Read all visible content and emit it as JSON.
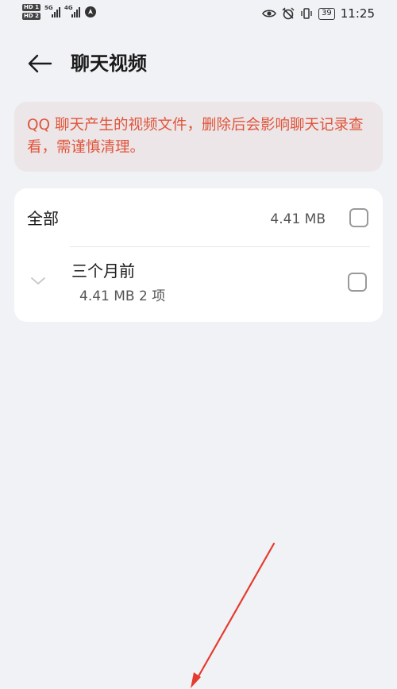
{
  "status_bar": {
    "hd1": "HD 1",
    "hd2": "HD 2",
    "net1": "5G",
    "net2": "4G",
    "battery": "39",
    "time": "11:25"
  },
  "header": {
    "title": "聊天视频"
  },
  "warning": {
    "text": "QQ 聊天产生的视频文件，删除后会影响聊天记录查看，需谨慎清理。"
  },
  "list": {
    "all_label": "全部",
    "all_size": "4.41 MB",
    "group_title": "三个月前",
    "group_meta": "4.41 MB 2 项"
  },
  "colors": {
    "warning_text": "#e0543a",
    "annotation_arrow": "#e53b2e"
  }
}
